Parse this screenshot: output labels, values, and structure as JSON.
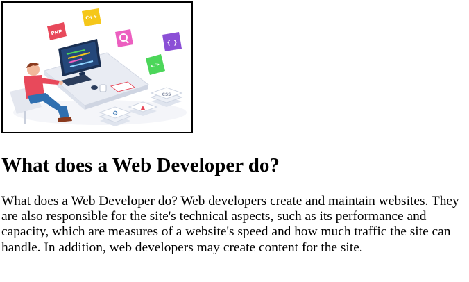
{
  "article": {
    "heading": "What does a Web Developer do?",
    "paragraph": "What does a Web Developer do? Web developers create and maintain websites. They are also responsible for the site's technical aspects, such as its performance and capacity, which are measures of a website's speed and how much traffic the site can handle. In addition, web developers may create content for the site."
  },
  "illustration": {
    "badges": {
      "php": "PHP",
      "cpp": "C++",
      "braces": "{ }",
      "code_tag": "</>",
      "css": "CSS"
    }
  },
  "colors": {
    "php_badge": "#e8495b",
    "cpp_badge": "#f5c71a",
    "search_badge": "#ec5fc0",
    "braces_badge": "#8b4fd6",
    "code_badge": "#4cd65a",
    "desk": "#e9ecf3",
    "monitor_screen": "#1f3d6b",
    "shirt": "#e8495b",
    "pants": "#2f6fb0"
  }
}
